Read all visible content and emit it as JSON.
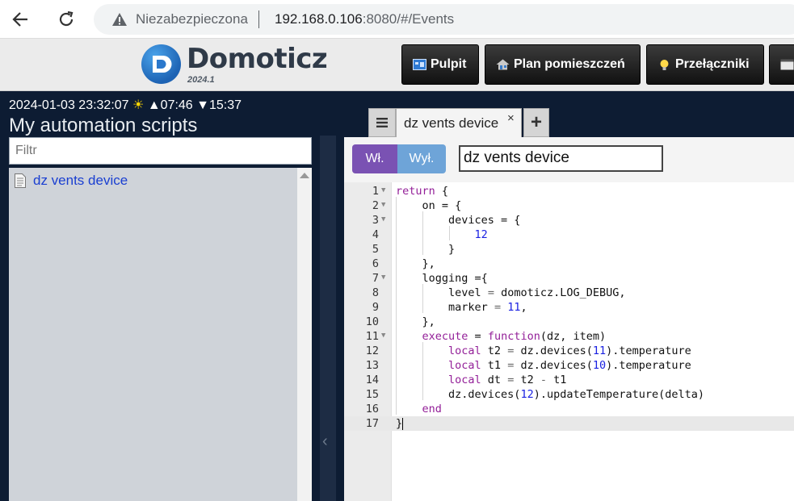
{
  "browser": {
    "security_label": "Niezabezpieczona",
    "url_host": "192.168.0.106",
    "url_rest": ":8080/#/Events"
  },
  "header": {
    "logo_name": "Domoticz",
    "logo_version": "2024.1",
    "nav": [
      {
        "label": "Pulpit",
        "icon": "dashboard-icon"
      },
      {
        "label": "Plan pomieszczeń",
        "icon": "house-icon"
      },
      {
        "label": "Przełączniki",
        "icon": "lightbulb-icon"
      },
      {
        "label": "",
        "icon": "scenes-icon"
      }
    ]
  },
  "sidebar": {
    "date_time": "2024-01-03 23:32:07",
    "sunrise": "▲07:46",
    "sunset": "▼15:37",
    "title": "My automation scripts",
    "filter_placeholder": "Filtr",
    "scripts": [
      {
        "name": "dz vents device"
      }
    ]
  },
  "editor": {
    "tab_label": "dz vents device",
    "tab_close": "×",
    "tab_add": "+",
    "toggle_on_label": "Wł.",
    "toggle_off_label": "Wył.",
    "script_name": "dz vents device",
    "lines": [
      {
        "n": "1",
        "fold": true
      },
      {
        "n": "2",
        "fold": true
      },
      {
        "n": "3",
        "fold": true
      },
      {
        "n": "4",
        "fold": false
      },
      {
        "n": "5",
        "fold": false
      },
      {
        "n": "6",
        "fold": false
      },
      {
        "n": "7",
        "fold": true
      },
      {
        "n": "8",
        "fold": false
      },
      {
        "n": "9",
        "fold": false
      },
      {
        "n": "10",
        "fold": false
      },
      {
        "n": "11",
        "fold": true
      },
      {
        "n": "12",
        "fold": false
      },
      {
        "n": "13",
        "fold": false
      },
      {
        "n": "14",
        "fold": false
      },
      {
        "n": "15",
        "fold": false
      },
      {
        "n": "16",
        "fold": false
      },
      {
        "n": "17",
        "fold": false
      }
    ],
    "code": {
      "l1_kw": "return",
      "l1_rest": " {",
      "l2": "on = {",
      "l3": "devices = {",
      "l4": "12",
      "l5": "}",
      "l6": "},",
      "l7": "logging ={",
      "l8_a": "level ",
      "l8_b": "=",
      "l8_c": " domoticz.LOG_DEBUG,",
      "l9_a": "marker ",
      "l9_b": "=",
      "l9_num": "11",
      "l9_c": ",",
      "l10": "},",
      "l11_kw1": "execute",
      "l11_b": " = ",
      "l11_kw2": "function",
      "l11_c": "(dz, item)",
      "l12_kw": "local",
      "l12_a": " t2 ",
      "l12_b": "=",
      "l12_c": " dz.devices(",
      "l12_num": "11",
      "l12_d": ").temperature",
      "l13_kw": "local",
      "l13_a": " t1 ",
      "l13_b": "=",
      "l13_c": " dz.devices(",
      "l13_num": "10",
      "l13_d": ").temperature",
      "l14_kw": "local",
      "l14_a": " dt ",
      "l14_b": "=",
      "l14_c": " t2 ",
      "l14_d": "-",
      "l14_e": " t1",
      "l15_a": "dz.devices(",
      "l15_num": "12",
      "l15_b": ").updateTemperature(delta)",
      "l16_kw": "end",
      "l17": "}"
    }
  },
  "colors": {
    "page_bg": "#0d1c33",
    "toggle_on": "#7a52b3",
    "toggle_off": "#6ea4d8",
    "link": "#1a3fd1",
    "keyword": "#931f98",
    "number": "#1b22e2"
  }
}
